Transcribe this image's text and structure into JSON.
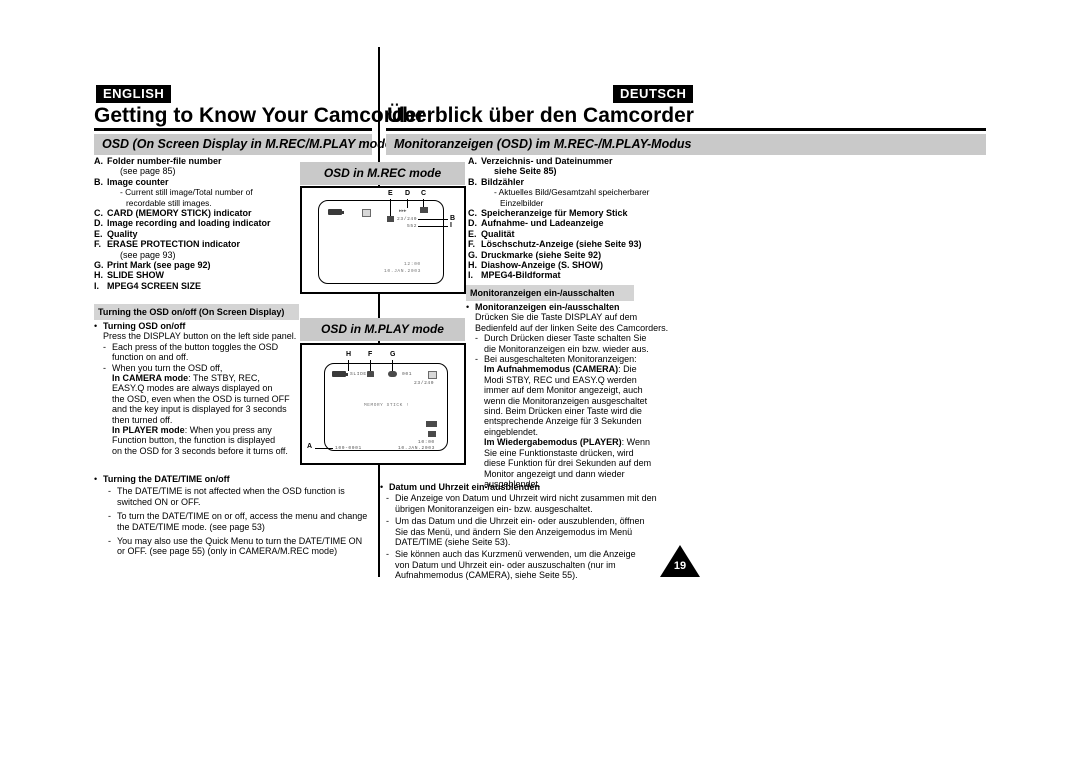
{
  "page": {
    "number": "19"
  },
  "english": {
    "badge": "ENGLISH",
    "chapter_title": "Getting to Know Your Camcorder",
    "banner": "OSD (On Screen Display in M.REC/M.PLAY modes)",
    "legend": [
      {
        "key": "A.",
        "label": "Folder number-file number",
        "sub": "(see page 85)"
      },
      {
        "key": "B.",
        "label": "Image counter",
        "dash": "- Current still image/Total number of",
        "dash2": "recordable still images."
      },
      {
        "key": "C.",
        "label": "CARD (MEMORY STICK) indicator"
      },
      {
        "key": "D.",
        "label": "Image recording and loading indicator"
      },
      {
        "key": "E.",
        "label": "Quality"
      },
      {
        "key": "F.",
        "label": "ERASE PROTECTION indicator",
        "sub": "(see page 93)"
      },
      {
        "key": "G.",
        "label": "Print Mark (see page 92)"
      },
      {
        "key": "H.",
        "label": "SLIDE SHOW"
      },
      {
        "key": "I.",
        "label": "MPEG4 SCREEN SIZE"
      }
    ],
    "osd_strip": "Turning the OSD on/off (On Screen Display)",
    "osd_bullet": "Turning OSD on/off",
    "osd_lines": [
      "Press the DISPLAY button on the left side panel."
    ],
    "osd_dash1": [
      "Each press of the button toggles the OSD",
      "function on and off."
    ],
    "osd_dash2_first": "When you turn the OSD off,",
    "osd_camera_bold": "In CAMERA mode",
    "osd_camera_rest": ": The STBY, REC,",
    "osd_camera_lines": [
      "EASY.Q modes are always displayed on",
      "the OSD, even when the OSD is turned OFF",
      "and the key input is displayed for 3 seconds",
      "then turned off."
    ],
    "osd_player_bold": "In PLAYER mode",
    "osd_player_rest": ": When you press any",
    "osd_player_lines": [
      "Function button, the function is displayed",
      "on the OSD for 3 seconds before it turns off."
    ],
    "datetime_bullet": "Turning the DATE/TIME on/off",
    "datetime_items": [
      [
        "The DATE/TIME is not affected when the OSD function is",
        "switched ON or OFF."
      ],
      [
        "To turn the DATE/TIME on or off, access the menu and change",
        "the DATE/TIME mode. (see page 53)"
      ],
      [
        "You may also use the Quick Menu to turn the DATE/TIME ON",
        "or OFF. (see page 55) (only in CAMERA/M.REC mode)"
      ]
    ]
  },
  "german": {
    "badge": "DEUTSCH",
    "chapter_title": "Überblick über den Camcorder",
    "banner": "Monitoranzeigen (OSD) im M.REC-/M.PLAY-Modus",
    "legend": [
      {
        "key": "A.",
        "label": "Verzeichnis- und Dateinummer",
        "sub": "siehe Seite 85)"
      },
      {
        "key": "B.",
        "label": "Bildzähler",
        "dash": "- Aktuelles Bild/Gesamtzahl speicherbarer",
        "dash2": "Einzelbilder"
      },
      {
        "key": "C.",
        "label": "Speicheranzeige für Memory Stick"
      },
      {
        "key": "D.",
        "label": "Aufnahme- und Ladeanzeige"
      },
      {
        "key": "E.",
        "label": "Qualität"
      },
      {
        "key": "F.",
        "label": "Löschschutz-Anzeige (siehe Seite 93)"
      },
      {
        "key": "G.",
        "label": "Druckmarke (siehe Seite 92)"
      },
      {
        "key": "H.",
        "label": "Diashow-Anzeige (S. SHOW)"
      },
      {
        "key": "I.",
        "label": "MPEG4-Bildformat"
      }
    ],
    "osd_strip": "Monitoranzeigen ein-/ausschalten",
    "osd_bullet": "Monitoranzeigen ein-/ausschalten",
    "osd_lines": [
      "Drücken Sie die Taste DISPLAY auf dem",
      "Bedienfeld auf der linken Seite des Camcorders."
    ],
    "osd_dash1": [
      "Durch Drücken dieser Taste schalten Sie",
      "die Monitoranzeigen ein bzw. wieder aus."
    ],
    "osd_dash2_first": "Bei ausgeschalteten Monitoranzeigen:",
    "osd_camera_bold": "Im Aufnahmemodus (CAMERA)",
    "osd_camera_rest": ": Die",
    "osd_camera_lines": [
      "Modi STBY, REC und EASY.Q werden",
      "immer auf dem Monitor angezeigt, auch",
      "wenn die Monitoranzeigen ausgeschaltet",
      "sind. Beim Drücken einer Taste wird die",
      "entsprechende Anzeige für 3 Sekunden",
      "eingeblendet."
    ],
    "osd_player_bold": "Im Wiedergabemodus (PLAYER)",
    "osd_player_rest": ": Wenn",
    "osd_player_lines": [
      "Sie eine Funktionstaste drücken, wird",
      "diese Funktion für drei Sekunden auf dem",
      "Monitor angezeigt und dann wieder",
      "ausgeblendet."
    ],
    "datetime_bullet": "Datum und Uhrzeit ein-/ausblenden",
    "datetime_items": [
      [
        "Die Anzeige von Datum und Uhrzeit wird nicht zusammen mit den",
        "übrigen Monitoranzeigen ein- bzw. ausgeschaltet."
      ],
      [
        "Um das Datum und die Uhrzeit ein- oder auszublenden, öffnen",
        "Sie das Menü, und ändern Sie den Anzeigemodus im Menü",
        "DATE/TIME (siehe Seite 53)."
      ],
      [
        "Sie können auch das Kurzmenü verwenden, um die Anzeige",
        "von Datum und Uhrzeit ein- oder auszuschalten (nur im",
        "Aufnahmemodus (CAMERA), siehe Seite 55)."
      ]
    ]
  },
  "osd_mrec": {
    "title": "OSD in M.REC mode",
    "labels": {
      "b": "B",
      "c": "C",
      "d": "D",
      "e": "E",
      "i": "I"
    },
    "counter": "23/240",
    "size": "552",
    "time": "12:00",
    "date": "10.JAN.2003"
  },
  "osd_mplay": {
    "title": "OSD in M.PLAY mode",
    "labels": {
      "a": "A",
      "f": "F",
      "g": "G",
      "h": "H"
    },
    "slide": "SLIDE",
    "print_count": "001",
    "counter": "23/240",
    "memory_stick": "MEMORY STICK !",
    "file": "100-0001",
    "time": "10:00",
    "date": "10.JAN.2003"
  }
}
